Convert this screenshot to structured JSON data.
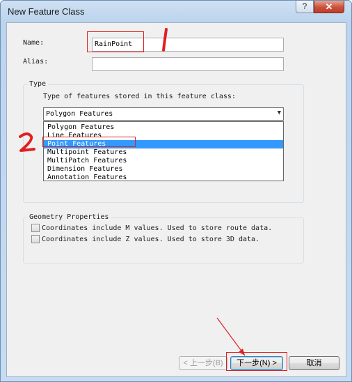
{
  "window": {
    "title": "New Feature Class",
    "help": "?",
    "close": "✕"
  },
  "name": {
    "label": "Name:",
    "value": "RainPoint"
  },
  "alias": {
    "label": "Alias:",
    "value": ""
  },
  "type_group": {
    "title": "Type",
    "prompt": "Type of features stored in this feature class:",
    "selected": "Polygon Features",
    "options": [
      "Polygon Features",
      "Line Features",
      "Point Features",
      "Multipoint Features",
      "MultiPatch Features",
      "Dimension Features",
      "Annotation Features"
    ],
    "highlighted": "Point Features"
  },
  "geometry_group": {
    "title": "Geometry Properties",
    "m_values": {
      "label": "Coordinates include M values. Used to store route data.",
      "checked": false
    },
    "z_values": {
      "label": "Coordinates include Z values. Used to store 3D data.",
      "checked": false
    }
  },
  "buttons": {
    "back": "< 上一步(B)",
    "next": "下一步(N) >",
    "cancel": "取消"
  },
  "colors": {
    "annotation": "#e02020",
    "selection": "#3399ff"
  }
}
